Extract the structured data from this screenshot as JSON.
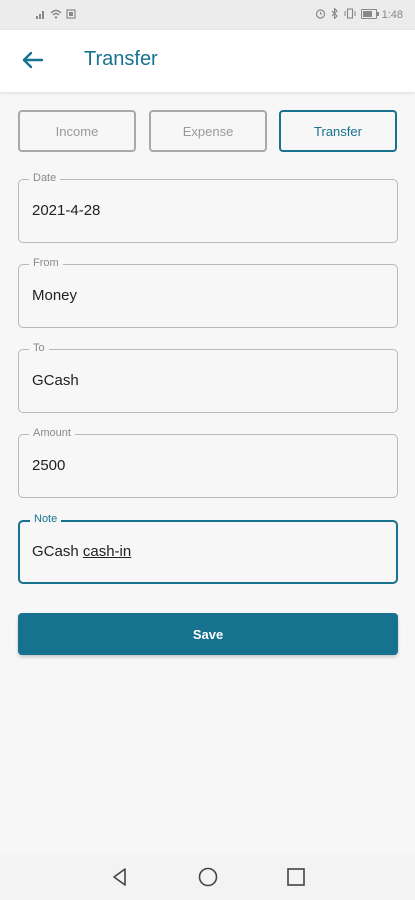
{
  "status_bar": {
    "time": "1:48",
    "left_icons": [
      "signal-icon",
      "wifi-icon",
      "sim-icon"
    ],
    "right_icons": [
      "alarm-icon",
      "bluetooth-icon",
      "vibrate-icon",
      "battery-icon"
    ],
    "battery_level": 0.75
  },
  "app_bar": {
    "title": "Transfer",
    "back_icon": "arrow-left-icon"
  },
  "type_tabs": {
    "items": [
      {
        "label": "Income",
        "active": false
      },
      {
        "label": "Expense",
        "active": false
      },
      {
        "label": "Transfer",
        "active": true
      }
    ]
  },
  "form": {
    "date": {
      "label": "Date",
      "value": "2021-4-28"
    },
    "from": {
      "label": "From",
      "value": "Money"
    },
    "to": {
      "label": "To",
      "value": "GCash"
    },
    "amount": {
      "label": "Amount",
      "value": "2500"
    },
    "note": {
      "label": "Note",
      "value_word1": "GCash",
      "value_word2": "cash-in"
    }
  },
  "save_button": {
    "label": "Save"
  },
  "nav_bar": {
    "icons": [
      "back-triangle-icon",
      "home-circle-icon",
      "recents-square-icon"
    ]
  },
  "colors": {
    "accent": "#17728f",
    "background": "#f7f7f7",
    "inactive_border": "#a9a9a9"
  }
}
